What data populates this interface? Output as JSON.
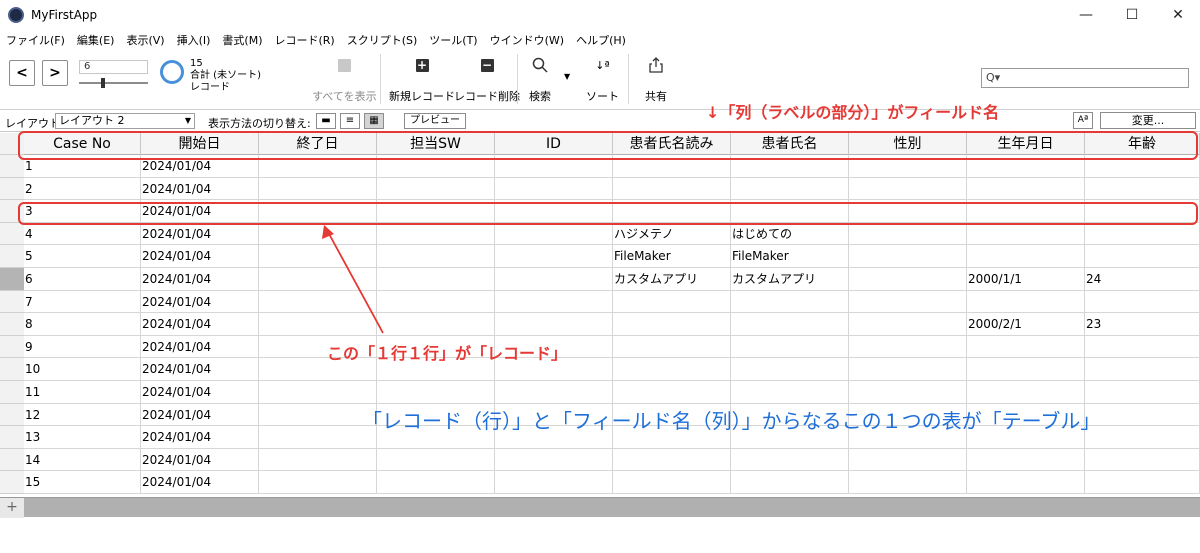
{
  "window": {
    "title": "MyFirstApp",
    "min_glyph": "—",
    "max_glyph": "☐",
    "close_glyph": "✕"
  },
  "menu": [
    "ファイル(F)",
    "編集(E)",
    "表示(V)",
    "挿入(I)",
    "書式(M)",
    "レコード(R)",
    "スクリプト(S)",
    "ツール(T)",
    "ウインドウ(W)",
    "ヘルプ(H)"
  ],
  "toolbar": {
    "prev_glyph": "<",
    "next_glyph": ">",
    "record_number": "6",
    "record_count": "15",
    "record_total_label": "合計 (未ソート)",
    "record_unit_label": "レコード",
    "show_all": "すべてを表示",
    "new_record": "新規レコード",
    "delete_record": "レコード削除",
    "find": "検索",
    "sort": "ソート",
    "share": "共有",
    "search_placeholder": "Q▾"
  },
  "layoutbar": {
    "layout_label": "レイアウト:",
    "layout_value": "レイアウト 2",
    "view_as_label": "表示方法の切り替え:",
    "preview": "プレビュー",
    "aa": "Aª",
    "change": "変更..."
  },
  "table": {
    "columns": [
      "Case No",
      "開始日",
      "終了日",
      "担当SW",
      "ID",
      "患者氏名読み",
      "患者氏名",
      "性別",
      "生年月日",
      "年齢"
    ],
    "rows": [
      [
        "1",
        "2024/01/04",
        "",
        "",
        "",
        "",
        "",
        "",
        "",
        ""
      ],
      [
        "2",
        "2024/01/04",
        "",
        "",
        "",
        "",
        "",
        "",
        "",
        ""
      ],
      [
        "3",
        "2024/01/04",
        "",
        "",
        "",
        "",
        "",
        "",
        "",
        ""
      ],
      [
        "4",
        "2024/01/04",
        "",
        "",
        "",
        "ハジメテノ",
        "はじめての",
        "",
        "",
        ""
      ],
      [
        "5",
        "2024/01/04",
        "",
        "",
        "",
        "FileMaker",
        "FileMaker",
        "",
        "",
        ""
      ],
      [
        "6",
        "2024/01/04",
        "",
        "",
        "",
        "カスタムアプリ",
        "カスタムアプリ",
        "",
        "2000/1/1",
        "24"
      ],
      [
        "7",
        "2024/01/04",
        "",
        "",
        "",
        "",
        "",
        "",
        "",
        ""
      ],
      [
        "8",
        "2024/01/04",
        "",
        "",
        "",
        "",
        "",
        "",
        "2000/2/1",
        "23"
      ],
      [
        "9",
        "2024/01/04",
        "",
        "",
        "",
        "",
        "",
        "",
        "",
        ""
      ],
      [
        "10",
        "2024/01/04",
        "",
        "",
        "",
        "",
        "",
        "",
        "",
        ""
      ],
      [
        "11",
        "2024/01/04",
        "",
        "",
        "",
        "",
        "",
        "",
        "",
        ""
      ],
      [
        "12",
        "2024/01/04",
        "",
        "",
        "",
        "",
        "",
        "",
        "",
        ""
      ],
      [
        "13",
        "2024/01/04",
        "",
        "",
        "",
        "",
        "",
        "",
        "",
        ""
      ],
      [
        "14",
        "2024/01/04",
        "",
        "",
        "",
        "",
        "",
        "",
        "",
        ""
      ],
      [
        "15",
        "2024/01/04",
        "",
        "",
        "",
        "",
        "",
        "",
        "",
        ""
      ]
    ],
    "add_row_glyph": "+"
  },
  "annotations": {
    "field_note": "↓「列（ラベルの部分）」がフィールド名",
    "record_note": "この「１行１行」が「レコード」",
    "table_note": "「レコード（行）」と「フィールド名（列）」からなるこの１つの表が「テーブル」"
  },
  "colors": {
    "annotation_red": "#e53935",
    "annotation_blue": "#1e6fd9"
  }
}
